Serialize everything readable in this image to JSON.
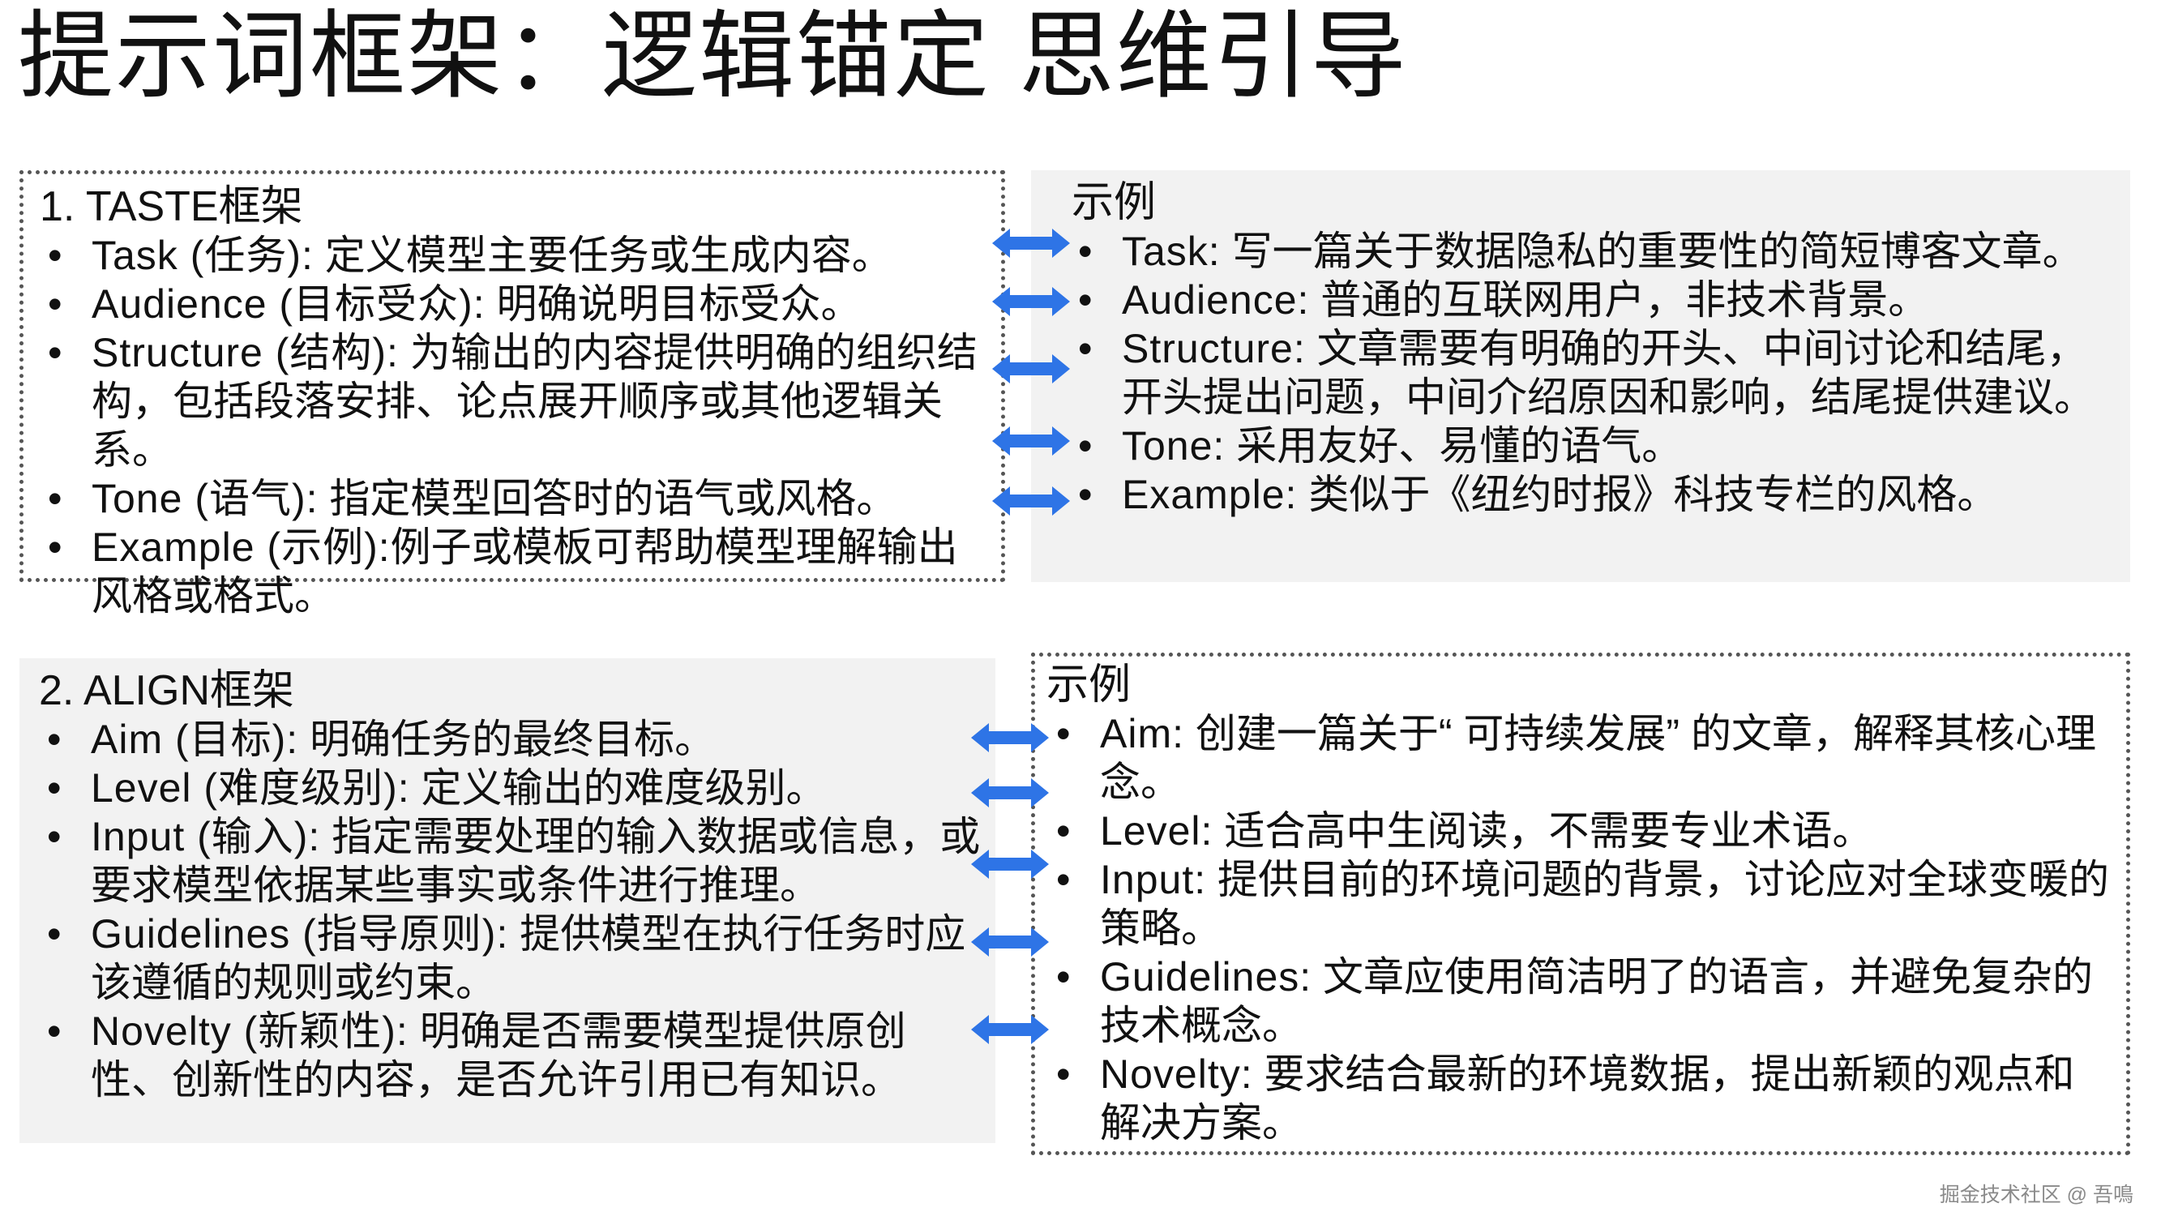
{
  "title": "提示词框架：逻辑锚定 思维引导",
  "taste": {
    "heading": "1. TASTE框架",
    "items": [
      {
        "label": "Task (任务):",
        "text": " 定义模型主要任务或生成内容。"
      },
      {
        "label": "Audience (目标受众):",
        "text": " 明确说明目标受众。"
      },
      {
        "label": "Structure (结构):",
        "text": " 为输出的内容提供明确的组织结构，包括段落安排、论点展开顺序或其他逻辑关系。"
      },
      {
        "label": "Tone (语气):",
        "text": " 指定模型回答时的语气或风格。"
      },
      {
        "label": "Example (示例):",
        "text": "例子或模板可帮助模型理解输出风格或格式。"
      }
    ]
  },
  "taste_example": {
    "heading": "示例",
    "items": [
      {
        "label": "Task:",
        "text": " 写一篇关于数据隐私的重要性的简短博客文章。"
      },
      {
        "label": "Audience:",
        "text": " 普通的互联网用户，非技术背景。"
      },
      {
        "label": "Structure:",
        "text": " 文章需要有明确的开头、中间讨论和结尾，开头提出问题，中间介绍原因和影响，结尾提供建议。"
      },
      {
        "label": "Tone:",
        "text": " 采用友好、易懂的语气。"
      },
      {
        "label": "Example:",
        "text": " 类似于《纽约时报》科技专栏的风格。"
      }
    ]
  },
  "align": {
    "heading": "2. ALIGN框架",
    "items": [
      {
        "label": "Aim (目标):",
        "text": " 明确任务的最终目标。"
      },
      {
        "label": "Level (难度级别):",
        "text": " 定义输出的难度级别。"
      },
      {
        "label": "Input (输入):",
        "text": " 指定需要处理的输入数据或信息，或要求模型依据某些事实或条件进行推理。"
      },
      {
        "label": "Guidelines (指导原则):",
        "text": " 提供模型在执行任务时应该遵循的规则或约束。"
      },
      {
        "label": "Novelty (新颖性):",
        "text": " 明确是否需要模型提供原创性、创新性的内容，是否允许引用已有知识。"
      }
    ]
  },
  "align_example": {
    "heading": "示例",
    "items": [
      {
        "label": "Aim:",
        "text": " 创建一篇关于“ 可持续发展” 的文章，解释其核心理念。"
      },
      {
        "label": "Level:",
        "text": " 适合高中生阅读，不需要专业术语。"
      },
      {
        "label": "Input:",
        "text": " 提供目前的环境问题的背景，讨论应对全球变暖的策略。"
      },
      {
        "label": "Guidelines:",
        "text": " 文章应使用简洁明了的语言，并避免复杂的技术概念。"
      },
      {
        "label": "Novelty:",
        "text": " 要求结合最新的环境数据，提出新颖的观点和解决方案。"
      }
    ]
  },
  "bullet": "•",
  "colors": {
    "arrow": "#2e74e6",
    "panel_gray": "#f2f2f2",
    "dotted_border": "#555555"
  },
  "watermark": "掘金技术社区 @ 吾鳴"
}
